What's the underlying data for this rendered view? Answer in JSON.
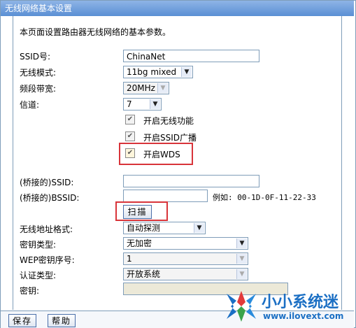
{
  "window": {
    "title": "无线网络基本设置"
  },
  "description": "本页面设置路由器无线网络的基本参数。",
  "form": {
    "ssid_label": "SSID号:",
    "ssid_value": "ChinaNet",
    "mode_label": "无线模式:",
    "mode_value": "11bg mixed",
    "bandwidth_label": "频段带宽:",
    "bandwidth_value": "20MHz",
    "channel_label": "信道:",
    "channel_value": "7",
    "enable_wireless_label": "开启无线功能",
    "enable_ssid_broadcast_label": "开启SSID广播",
    "enable_wds_label": "开启WDS",
    "bridged_ssid_label": "(桥接的)SSID:",
    "bridged_ssid_value": "",
    "bridged_bssid_label": "(桥接的)BSSID:",
    "bridged_bssid_value": "",
    "bssid_example": "例如: 00-1D-0F-11-22-33",
    "scan_button": "扫描",
    "address_format_label": "无线地址格式:",
    "address_format_value": "自动探测",
    "key_type_label": "密钥类型:",
    "key_type_value": "无加密",
    "wep_index_label": "WEP密钥序号:",
    "wep_index_value": "1",
    "auth_type_label": "认证类型:",
    "auth_type_value": "开放系统",
    "key_label": "密钥:",
    "key_value": ""
  },
  "footer": {
    "save_button": "保存",
    "help_button": "帮助"
  },
  "watermark": {
    "title": "小小系统迷",
    "url": "www.ilovext.com"
  },
  "colors": {
    "title_bar": "#5a8fd4",
    "highlight_box": "#d8343a",
    "border": "#7f9db9",
    "watermark": "#1b6fc4"
  }
}
